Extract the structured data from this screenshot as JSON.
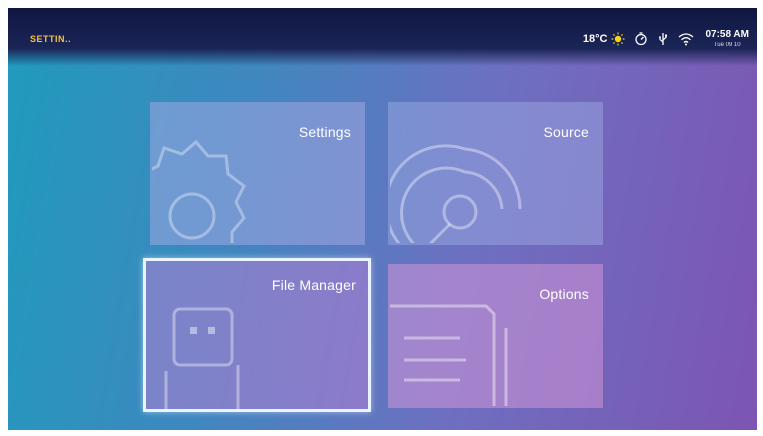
{
  "header": {
    "title": "SETTIN..",
    "temperature": "18°C",
    "time": "07:58 AM",
    "date": "Tue 09 10"
  },
  "icons": {
    "weather": "sun-icon",
    "status_1": "timer-icon",
    "status_2": "usb-icon",
    "status_3": "wifi-icon"
  },
  "tiles": [
    {
      "label": "Settings",
      "icon": "gear-icon"
    },
    {
      "label": "Source",
      "icon": "source-signal-icon"
    },
    {
      "label": "File Manager",
      "icon": "file-manager-icon",
      "selected": true
    },
    {
      "label": "Options",
      "icon": "options-document-icon"
    }
  ],
  "colors": {
    "title_accent": "#f5c242",
    "sun": "#f7d31b",
    "focus_border": "#e9f4ff"
  }
}
